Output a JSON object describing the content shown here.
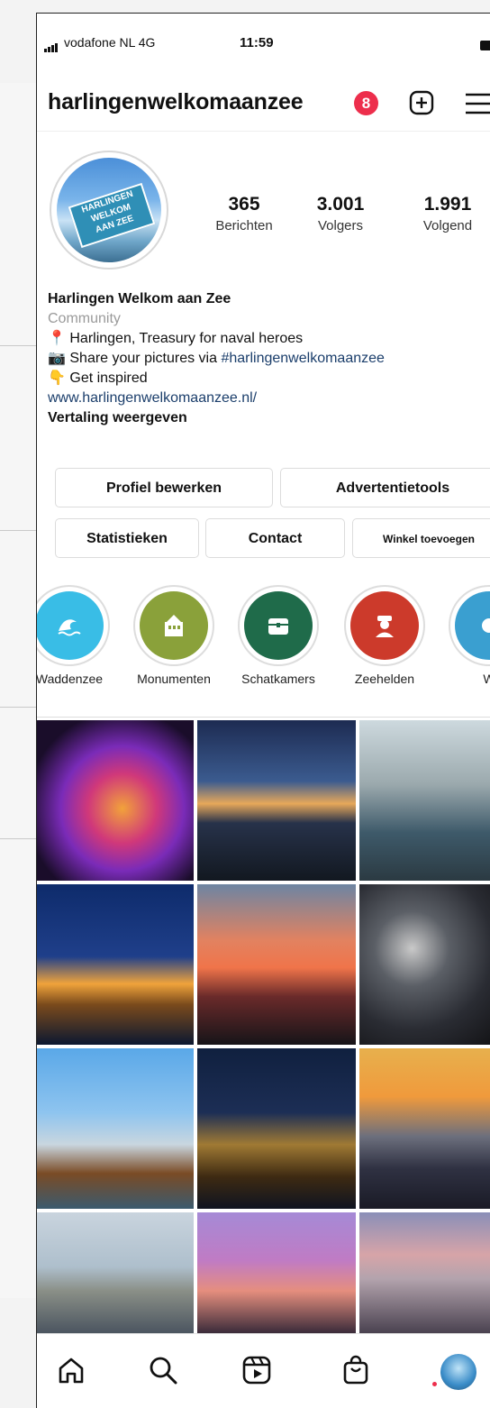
{
  "status": {
    "carrier": "vodafone NL  4G",
    "time": "11:59"
  },
  "header": {
    "username": "harlingenwelkomaanzee",
    "notification_count": "8"
  },
  "avatar_text": [
    "HARLINGEN",
    "WELKOM",
    "AAN ZEE"
  ],
  "stats": [
    {
      "value": "365",
      "label": "Berichten"
    },
    {
      "value": "3.001",
      "label": "Volgers"
    },
    {
      "value": "1.991",
      "label": "Volgend"
    }
  ],
  "bio": {
    "name": "Harlingen Welkom aan Zee",
    "category": "Community",
    "line1": "📍 Harlingen, Treasury for naval heroes",
    "line2_prefix": "📷 Share your pictures via ",
    "line2_hashtag": "#harlingenwelkomaanzee",
    "line3": "👇 Get inspired",
    "link": "www.harlingenwelkomaanzee.nl/",
    "translate": "Vertaling weergeven"
  },
  "buttons": {
    "edit_profile": "Profiel bewerken",
    "ad_tools": "Advertentietools",
    "statistics": "Statistieken",
    "contact": "Contact",
    "add_shop": "Winkel toevoegen"
  },
  "highlights": [
    {
      "label": "Waddenzee",
      "color": "#39bde6",
      "icon": "wave-icon"
    },
    {
      "label": "Monumenten",
      "color": "#8aa13a",
      "icon": "building-icon"
    },
    {
      "label": "Schatkamers",
      "color": "#1f6b4a",
      "icon": "treasure-chest-icon"
    },
    {
      "label": "Zeehelden",
      "color": "#cc3a2b",
      "icon": "captain-icon"
    },
    {
      "label": "W",
      "color": "#3a9fd0",
      "icon": "highlight-icon"
    }
  ],
  "tabs": [
    "home-icon",
    "search-icon",
    "reels-icon",
    "shop-icon",
    "profile-avatar"
  ]
}
